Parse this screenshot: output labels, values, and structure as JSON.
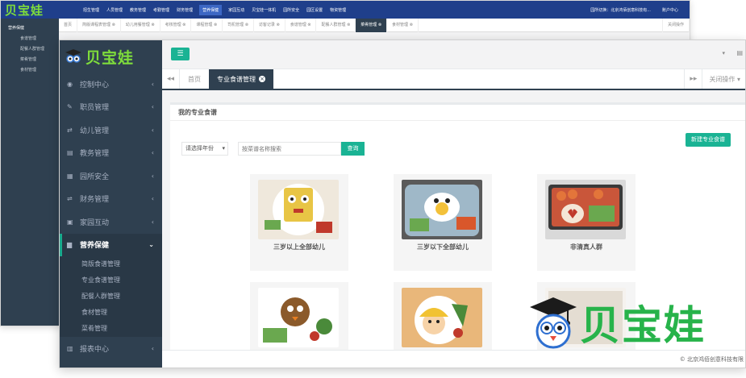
{
  "back_window": {
    "logo": "贝宝娃",
    "nav": [
      "招生管理",
      "人员管理",
      "教务管理",
      "考勤管理",
      "财务管理",
      "营养保健",
      "家园互动",
      "贝宝娃一体机",
      "园所安全",
      "园区设置",
      "物资管理"
    ],
    "nav_active": "营养保健",
    "top_right": [
      "园所切换：北京鸿佰创意科技有...",
      "账户中心"
    ],
    "side_header": "营养保健",
    "side_items": [
      "食谱管理",
      "配餐人群管理",
      "菜肴管理",
      "食材管理"
    ],
    "tabs": [
      "首页",
      "简版课程表管理 ⊗",
      "幼儿用餐管理 ⊗",
      "考核管理 ⊗",
      "课程管理 ⊗",
      "司机管理 ⊗",
      "访客记录 ⊗",
      "食谱管理 ⊗",
      "配餐人群管理 ⊗",
      "菜肴管理 ⊗",
      "食材管理 ⊗"
    ],
    "tab_active": "菜肴管理 ⊗",
    "close_ops": "关闭操作"
  },
  "logo": "贝宝娃",
  "sidebar": {
    "items": [
      {
        "icon": "dashboard-icon",
        "glyph": "◉",
        "label": "控制中心"
      },
      {
        "icon": "wrench-icon",
        "glyph": "✎",
        "label": "职员管理"
      },
      {
        "icon": "child-icon",
        "glyph": "⇄",
        "label": "幼儿管理"
      },
      {
        "icon": "book-icon",
        "glyph": "▤",
        "label": "教务管理"
      },
      {
        "icon": "cart-icon",
        "glyph": "▦",
        "label": "园所安全"
      },
      {
        "icon": "exchange-icon",
        "glyph": "⇌",
        "label": "财务管理"
      },
      {
        "icon": "image-icon",
        "glyph": "▣",
        "label": "家园互动"
      }
    ],
    "active": {
      "icon": "file-icon",
      "glyph": "▆",
      "label": "营养保健"
    },
    "sub_items": [
      "简版食谱管理",
      "专业食谱管理",
      "配餐人群管理",
      "食材管理",
      "菜肴管理"
    ],
    "bottom": {
      "icon": "report-icon",
      "glyph": "▥",
      "label": "报表中心"
    }
  },
  "topbar": {
    "menu_glyph": "☰",
    "dropdown": "▾",
    "icon": "▤"
  },
  "tabs": {
    "prev": "◂◂",
    "next": "▸▸",
    "home": "首页",
    "active": "专业食谱管理",
    "close_ops": "关闭操作"
  },
  "panel": {
    "title": "我的专业食谱",
    "new_button": "新建专业食谱",
    "select_value": "请选择年份",
    "search_placeholder": "按菜谱名称搜索",
    "query_button": "查询"
  },
  "cards": [
    {
      "label": "三岁以上全部幼儿"
    },
    {
      "label": "三岁以下全部幼儿"
    },
    {
      "label": "非清真人群"
    },
    {
      "label": ""
    },
    {
      "label": ""
    },
    {
      "label": ""
    }
  ],
  "footer": "© 北京鸿佰创意科技有限",
  "brand": "贝宝娃",
  "colors": {
    "accent": "#1ab394",
    "sidebar": "#2f4050",
    "topnav": "#1f3f8b",
    "brand_green": "#27b34a"
  }
}
